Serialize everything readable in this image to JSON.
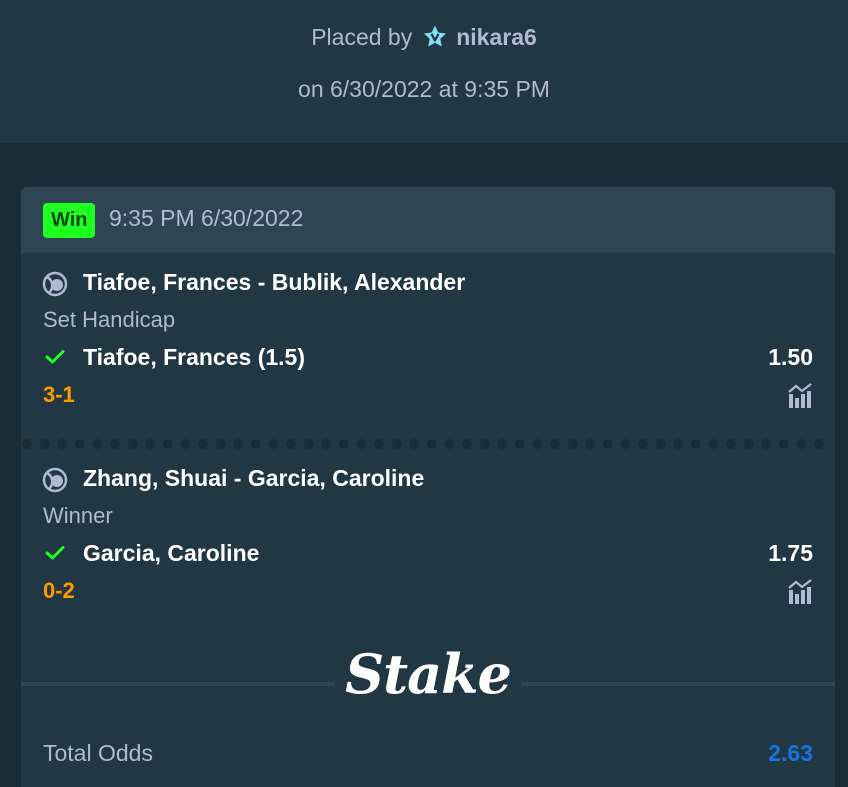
{
  "header": {
    "placed_by_label": "Placed by",
    "username": "nikara6",
    "vip_icon": "vip-star-icon",
    "date_line": "on 6/30/2022 at 9:35 PM"
  },
  "bet": {
    "status": "Win",
    "status_color": "#1fff20",
    "time": "9:35 PM 6/30/2022",
    "legs": [
      {
        "sport_icon": "tennis-ball-icon",
        "match": "Tiafoe, Frances - Bublik, Alexander",
        "market": "Set Handicap",
        "selection": "Tiafoe, Frances (1.5)",
        "odds": "1.50",
        "score": "3-1",
        "result_icon": "checkmark-icon",
        "stats_icon": "stats-icon"
      },
      {
        "sport_icon": "tennis-ball-icon",
        "match": "Zhang, Shuai - Garcia, Caroline",
        "market": "Winner",
        "selection": "Garcia, Caroline",
        "odds": "1.75",
        "score": "0-2",
        "result_icon": "checkmark-icon",
        "stats_icon": "stats-icon"
      }
    ],
    "brand": "Stake",
    "total_odds_label": "Total Odds",
    "total_odds_value": "2.63"
  },
  "colors": {
    "background": "#1a2c38",
    "panel": "#213743",
    "accent_blue": "#1475e1",
    "score_orange": "#ff9d00",
    "win_green": "#1fff20"
  }
}
